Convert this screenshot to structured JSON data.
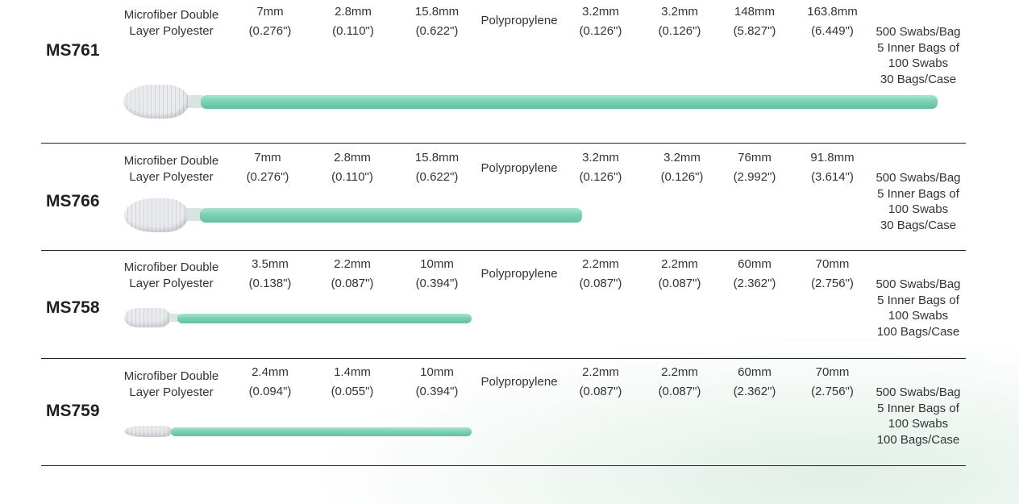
{
  "rows": [
    {
      "model": "MS761",
      "material": [
        "Microfiber Double",
        "Layer Polyester"
      ],
      "tip_width": [
        "7mm",
        "(0.276\")"
      ],
      "tip_thickness": [
        "2.8mm",
        "(0.110\")"
      ],
      "tip_length": [
        "15.8mm",
        "(0.622\")"
      ],
      "handle_material": "Polypropylene",
      "handle_width": [
        "3.2mm",
        "(0.126\")"
      ],
      "handle_thickness": [
        "3.2mm",
        "(0.126\")"
      ],
      "handle_length": [
        "148mm",
        "(5.827\")"
      ],
      "overall_length": [
        "163.8mm",
        "(6.449\")"
      ],
      "packaging": [
        "500 Swabs/Bag",
        "5 Inner Bags of",
        "100 Swabs",
        "30 Bags/Case"
      ]
    },
    {
      "model": "MS766",
      "material": [
        "Microfiber Double",
        "Layer Polyester"
      ],
      "tip_width": [
        "7mm",
        "(0.276\")"
      ],
      "tip_thickness": [
        "2.8mm",
        "(0.110\")"
      ],
      "tip_length": [
        "15.8mm",
        "(0.622\")"
      ],
      "handle_material": "Polypropylene",
      "handle_width": [
        "3.2mm",
        "(0.126\")"
      ],
      "handle_thickness": [
        "3.2mm",
        "(0.126\")"
      ],
      "handle_length": [
        "76mm",
        "(2.992\")"
      ],
      "overall_length": [
        "91.8mm",
        "(3.614\")"
      ],
      "packaging": [
        "500 Swabs/Bag",
        "5 Inner Bags of",
        "100 Swabs",
        "30 Bags/Case"
      ]
    },
    {
      "model": "MS758",
      "material": [
        "Microfiber Double",
        "Layer Polyester"
      ],
      "tip_width": [
        "3.5mm",
        "(0.138\")"
      ],
      "tip_thickness": [
        "2.2mm",
        "(0.087\")"
      ],
      "tip_length": [
        "10mm",
        "(0.394\")"
      ],
      "handle_material": "Polypropylene",
      "handle_width": [
        "2.2mm",
        "(0.087\")"
      ],
      "handle_thickness": [
        "2.2mm",
        "(0.087\")"
      ],
      "handle_length": [
        "60mm",
        "(2.362\")"
      ],
      "overall_length": [
        "70mm",
        "(2.756\")"
      ],
      "packaging": [
        "500 Swabs/Bag",
        "5 Inner Bags of",
        "100 Swabs",
        "100 Bags/Case"
      ]
    },
    {
      "model": "MS759",
      "material": [
        "Microfiber Double",
        "Layer Polyester"
      ],
      "tip_width": [
        "2.4mm",
        "(0.094\")"
      ],
      "tip_thickness": [
        "1.4mm",
        "(0.055\")"
      ],
      "tip_length": [
        "10mm",
        "(0.394\")"
      ],
      "handle_material": "Polypropylene",
      "handle_width": [
        "2.2mm",
        "(0.087\")"
      ],
      "handle_thickness": [
        "2.2mm",
        "(0.087\")"
      ],
      "handle_length": [
        "60mm",
        "(2.362\")"
      ],
      "overall_length": [
        "70mm",
        "(2.756\")"
      ],
      "packaging": [
        "500 Swabs/Bag",
        "5 Inner Bags of",
        "100 Swabs",
        "100 Bags/Case"
      ]
    }
  ]
}
